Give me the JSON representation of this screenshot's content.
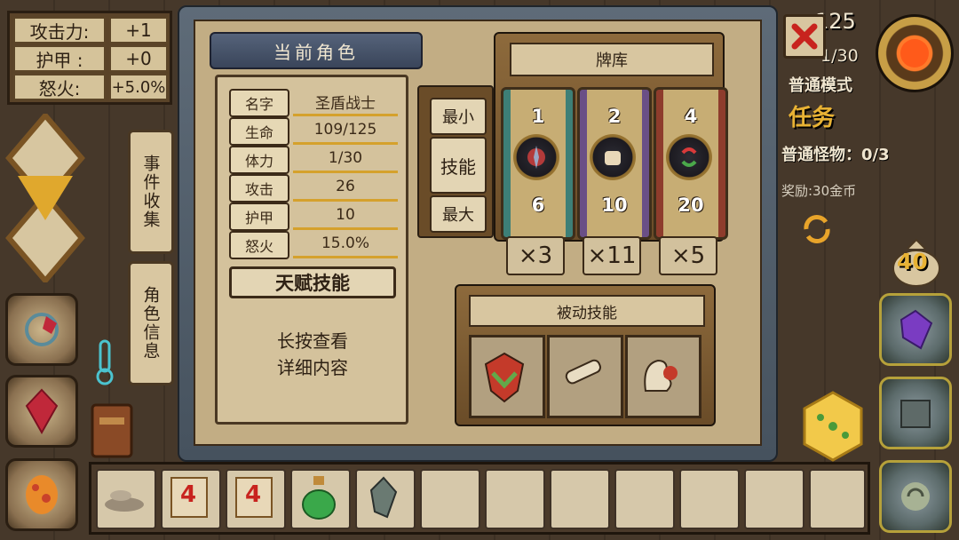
{
  "top_left_stats": [
    {
      "label": "攻击力:",
      "value": "+1"
    },
    {
      "label": "护甲 :",
      "value": "+0"
    },
    {
      "label": "怒火:",
      "value": "+5.0%"
    }
  ],
  "side_tabs": {
    "events": "事件收集",
    "character_info": "角色信息"
  },
  "character_panel": {
    "title": "当前角色",
    "stats": [
      {
        "label": "名字",
        "value": "圣盾战士"
      },
      {
        "label": "生命",
        "value": "109/125"
      },
      {
        "label": "体力",
        "value": "1/30"
      },
      {
        "label": "攻击",
        "value": "26"
      },
      {
        "label": "护甲",
        "value": "10"
      },
      {
        "label": "怒火",
        "value": "15.0%"
      }
    ],
    "talent_button": "天赋技能",
    "hint_line1": "长按查看",
    "hint_line2": "详细内容"
  },
  "deck": {
    "title": "牌库",
    "size_buttons": {
      "min": "最小",
      "skill": "技能",
      "max": "最大"
    },
    "cards": [
      {
        "top": "1",
        "bottom": "6",
        "count": "×3",
        "icon": "compass-icon",
        "color": "#3d7f77"
      },
      {
        "top": "2",
        "bottom": "10",
        "count": "×11",
        "icon": "fist-icon",
        "color": "#6a4f86"
      },
      {
        "top": "4",
        "bottom": "20",
        "count": "×5",
        "icon": "cycle-arrows-icon",
        "color": "#8e3c2c"
      }
    ]
  },
  "passive_skills": {
    "title": "被动技能",
    "icons": [
      "shield-heart-icon",
      "broken-bone-icon",
      "heart-hand-icon"
    ]
  },
  "hud": {
    "hp_partial": "125",
    "stamina_partial": "1/30",
    "mode": "普通模式",
    "task_title": "任务",
    "task_line": "普通怪物：0/3",
    "reward_line": "奖励:30金币",
    "gold": "40"
  },
  "inventory": [
    {
      "icon": "dust-pile-icon"
    },
    {
      "icon": "scroll-four-icon",
      "text": "4"
    },
    {
      "icon": "scroll-four-icon",
      "text": "4"
    },
    {
      "icon": "green-potion-icon"
    },
    {
      "icon": "crystal-icon"
    },
    {},
    {},
    {},
    {},
    {},
    {},
    {}
  ],
  "colors": {
    "accent": "#d5a12c",
    "panel_bg": "#c9b48c",
    "frame": "#5e6b78"
  }
}
